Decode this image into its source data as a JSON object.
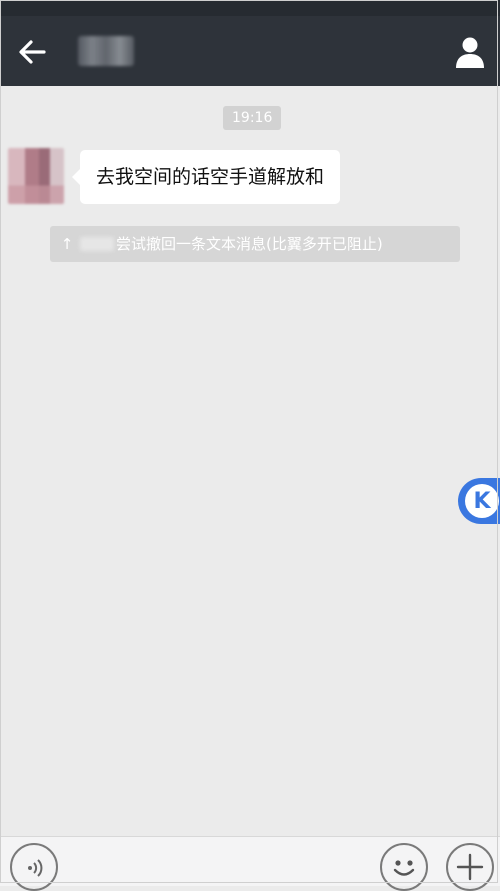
{
  "header": {
    "contact_name": "",
    "back_icon": "arrow-left-icon",
    "profile_icon": "person-icon"
  },
  "chat": {
    "timestamp": "19:16",
    "messages": [
      {
        "sender": "contact",
        "text": "去我空间的话空手道解放和"
      }
    ],
    "notice": {
      "arrow": "↑",
      "text": "尝试撤回一条文本消息(比翼多开已阻止)"
    }
  },
  "floating_button": {
    "label": "K"
  },
  "colors": {
    "header_bg": "#2e333a",
    "chat_bg": "#ebebeb",
    "accent": "#3a77e0"
  }
}
